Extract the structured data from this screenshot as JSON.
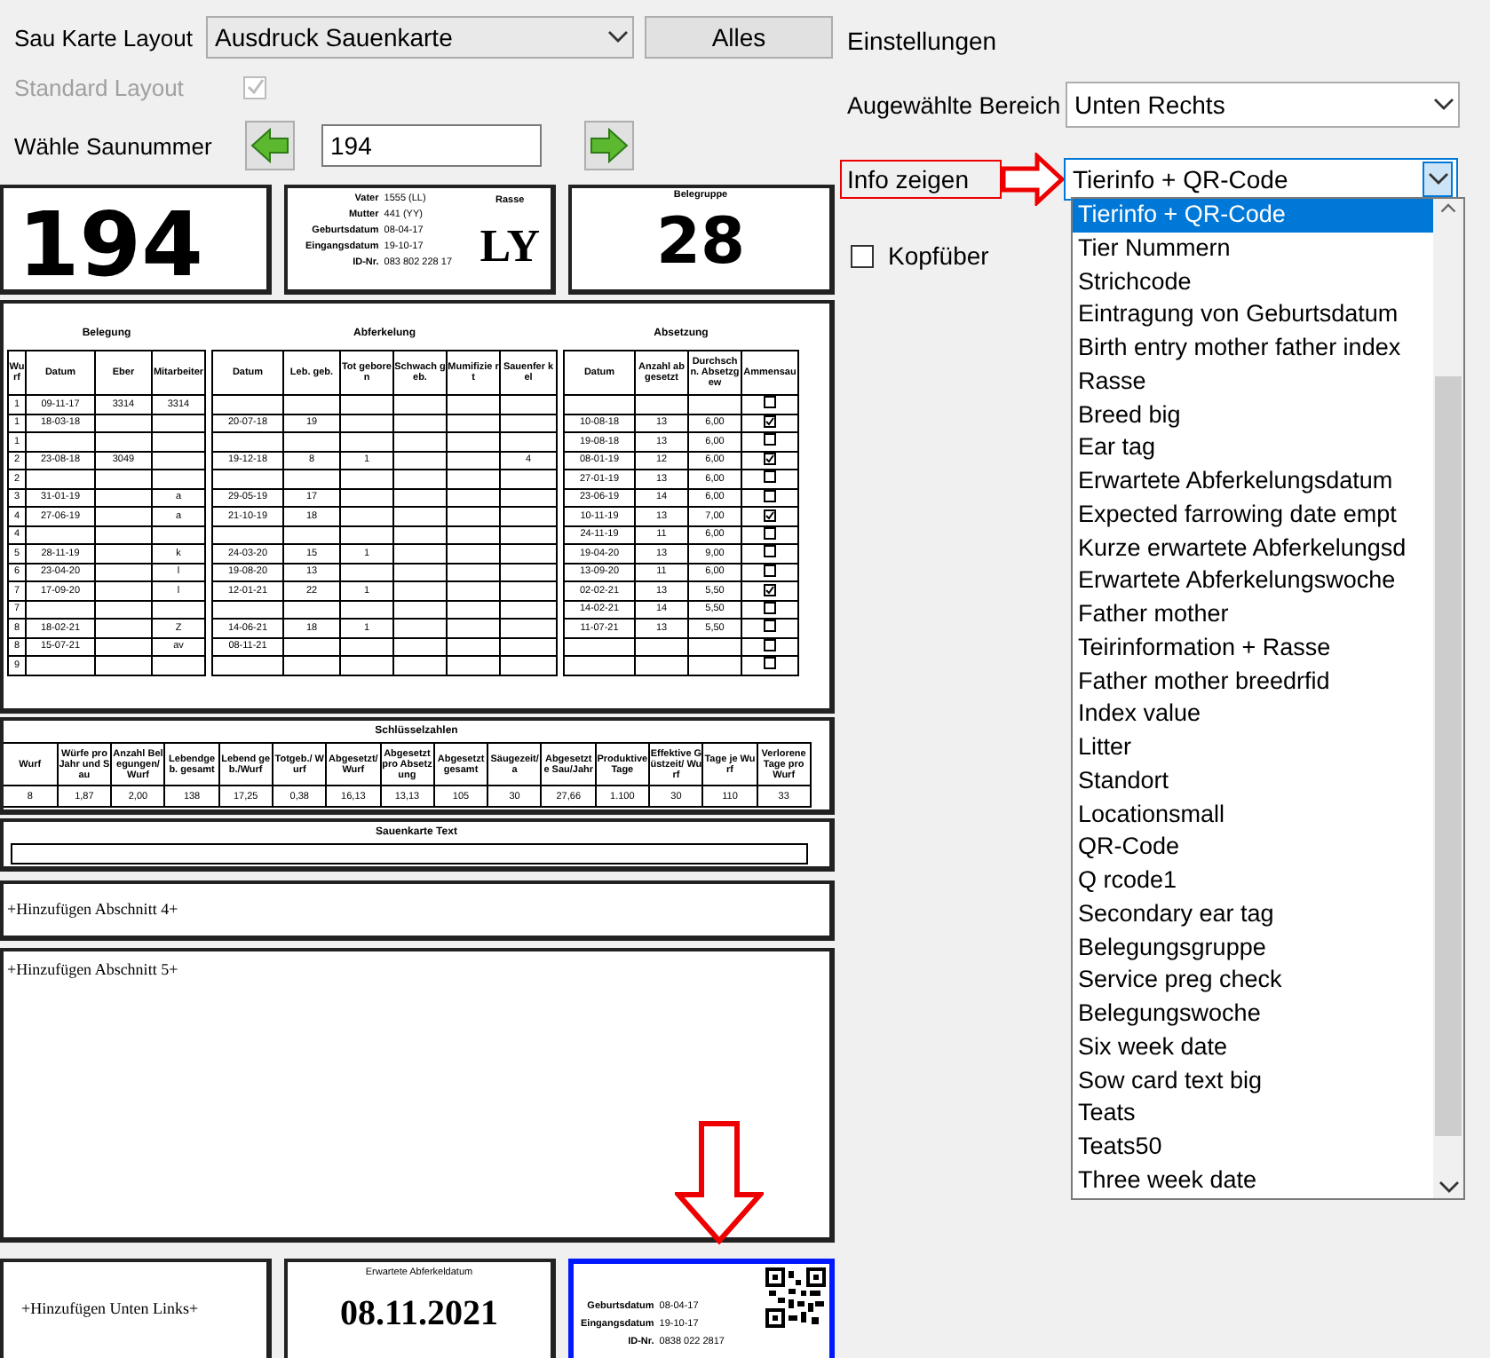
{
  "form": {
    "layout_label": "Sau Karte Layout",
    "layout_value": "Ausdruck Sauenkarte",
    "all_button": "Alles",
    "standard_layout": {
      "label": "Standard Layout",
      "checked": true,
      "disabled": true
    },
    "sow_label": "Wähle Saunummer",
    "sow_number": "194"
  },
  "card": {
    "sow_number": "194",
    "info": [
      {
        "label": "Vater",
        "value": "1555 (LL)"
      },
      {
        "label": "Mutter",
        "value": "441 (YY)"
      },
      {
        "label": "Geburtsdatum",
        "value": "08-04-17"
      },
      {
        "label": "Eingangsdatum",
        "value": "19-10-17"
      },
      {
        "label": "ID-Nr.",
        "value": "083 802 228 17"
      }
    ],
    "breed_label": "Rasse",
    "breed": "LY",
    "group_label": "Belegruppe",
    "group": "28",
    "history": {
      "groups": [
        {
          "title": "Belegung",
          "columns": [
            "Wurf",
            "Datum",
            "Eber",
            "Mitarbeiter"
          ]
        },
        {
          "title": "Abferkelung",
          "columns": [
            "Datum",
            "Leb. geb.",
            "Tot geboren",
            "Schwach geb.",
            "Mumifizie rt",
            "Sauenfer kel"
          ]
        },
        {
          "title": "Absetzung",
          "columns": [
            "Datum",
            "Anzahl abgesetzt",
            "Durchsch n. Absetzgew",
            "Ammensau"
          ]
        }
      ],
      "rows": [
        {
          "litter": "1",
          "mating_date": "09-11-17",
          "boar": "3314",
          "staff": "3314",
          "foster_sow": false
        },
        {
          "litter": "1",
          "mating_date": "18-03-18",
          "farrowing_date": "20-07-18",
          "born_alive": "19",
          "weaning_date": "10-08-18",
          "weaned": "13",
          "avg_weight": "6,00",
          "foster_sow": true
        },
        {
          "litter": "1",
          "weaning_date": "19-08-18",
          "weaned": "13",
          "avg_weight": "6,00",
          "foster_sow": false
        },
        {
          "litter": "2",
          "mating_date": "23-08-18",
          "boar": "3049",
          "farrowing_date": "19-12-18",
          "born_alive": "8",
          "stillborn": "1",
          "sow_piglets": "4",
          "weaning_date": "08-01-19",
          "weaned": "12",
          "avg_weight": "6,00",
          "foster_sow": true
        },
        {
          "litter": "2",
          "weaning_date": "27-01-19",
          "weaned": "13",
          "avg_weight": "6,00",
          "foster_sow": false
        },
        {
          "litter": "3",
          "mating_date": "31-01-19",
          "staff": "a",
          "farrowing_date": "29-05-19",
          "born_alive": "17",
          "weaning_date": "23-06-19",
          "weaned": "14",
          "avg_weight": "6,00",
          "foster_sow": false
        },
        {
          "litter": "4",
          "mating_date": "27-06-19",
          "staff": "a",
          "farrowing_date": "21-10-19",
          "born_alive": "18",
          "weaning_date": "10-11-19",
          "weaned": "13",
          "avg_weight": "7,00",
          "foster_sow": true
        },
        {
          "litter": "4",
          "weaning_date": "24-11-19",
          "weaned": "11",
          "avg_weight": "6,00",
          "foster_sow": false
        },
        {
          "litter": "5",
          "mating_date": "28-11-19",
          "staff": "k",
          "farrowing_date": "24-03-20",
          "born_alive": "15",
          "stillborn": "1",
          "weaning_date": "19-04-20",
          "weaned": "13",
          "avg_weight": "9,00",
          "foster_sow": false
        },
        {
          "litter": "6",
          "mating_date": "23-04-20",
          "staff": "l",
          "farrowing_date": "19-08-20",
          "born_alive": "13",
          "weaning_date": "13-09-20",
          "weaned": "11",
          "avg_weight": "6,00",
          "foster_sow": false
        },
        {
          "litter": "7",
          "mating_date": "17-09-20",
          "staff": "l",
          "farrowing_date": "12-01-21",
          "born_alive": "22",
          "stillborn": "1",
          "weaning_date": "02-02-21",
          "weaned": "13",
          "avg_weight": "5,50",
          "foster_sow": true
        },
        {
          "litter": "7",
          "weaning_date": "14-02-21",
          "weaned": "14",
          "avg_weight": "5,50",
          "foster_sow": false
        },
        {
          "litter": "8",
          "mating_date": "18-02-21",
          "staff": "Z",
          "farrowing_date": "14-06-21",
          "born_alive": "18",
          "stillborn": "1",
          "weaning_date": "11-07-21",
          "weaned": "13",
          "avg_weight": "5,50",
          "foster_sow": false
        },
        {
          "litter": "8",
          "mating_date": "15-07-21",
          "staff": "av",
          "farrowing_date": "08-11-21",
          "foster_sow": false
        },
        {
          "litter": "9",
          "foster_sow": false
        }
      ]
    },
    "key_figures": {
      "title": "Schlüsselzahlen",
      "columns": [
        "Wurf",
        "Würfe pro Jahr und Sau",
        "Anzahl Belegungen/ Wurf",
        "Lebendgeb. gesamt",
        "Lebend geb./Wurf",
        "Totgeb./ Wurf",
        "Abgesetzt/ Wurf",
        "Abgesetzt pro Absetzung",
        "Abgesetzt gesamt",
        "Säugezeit/ a",
        "Abgesetzte Sau/Jahr",
        "Produktive Tage",
        "Effektive Güstzeit/ Wurf",
        "Tage je Wurf",
        "Verlorene Tage pro Wurf"
      ],
      "values": [
        "8",
        "1,87",
        "2,00",
        "138",
        "17,25",
        "0,38",
        "16,13",
        "13,13",
        "105",
        "30",
        "27,66",
        "1.100",
        "30",
        "110",
        "33"
      ]
    },
    "text_section": {
      "title": "Sauenkarte Text"
    },
    "section_4": "+Hinzufügen Abschnitt 4+",
    "section_5": "+Hinzufügen Abschnitt 5+",
    "bottom_left": "+Hinzufügen Unten Links+",
    "expected": {
      "label": "Erwartete Abferkeldatum",
      "date": "08.11.2021"
    },
    "bottom_right": {
      "selected": true,
      "info": [
        {
          "label": "Geburtsdatum",
          "value": "08-04-17"
        },
        {
          "label": "Eingangsdatum",
          "value": "19-10-17"
        },
        {
          "label": "ID-Nr.",
          "value": "0838 022 2817"
        }
      ]
    }
  },
  "panel": {
    "title": "Einstellungen",
    "area_label": "Augewählte Bereich",
    "area_value": "Unten Rechts",
    "info_label": "Info zeigen",
    "info_select": {
      "value": "Tierinfo + QR-Code",
      "expanded": true,
      "options": [
        {
          "label": "Tierinfo + QR-Code",
          "selected": true
        },
        {
          "label": "Tier Nummern",
          "selected": false
        },
        {
          "label": "Strichcode",
          "selected": false
        },
        {
          "label": "Eintragung von Geburtsdatum",
          "selected": false
        },
        {
          "label": "Birth entry mother father index",
          "selected": false
        },
        {
          "label": "Rasse",
          "selected": false
        },
        {
          "label": "Breed big",
          "selected": false
        },
        {
          "label": "Ear tag",
          "selected": false
        },
        {
          "label": "Erwartete Abferkelungsdatum",
          "selected": false
        },
        {
          "label": "Expected  farrowing  date empt",
          "selected": false
        },
        {
          "label": "Kurze  erwartete Abferkelungsd",
          "selected": false
        },
        {
          "label": "Erwartete Abferkelungswoche",
          "selected": false
        },
        {
          "label": "Father mother",
          "selected": false
        },
        {
          "label": "Teirinformation + Rasse",
          "selected": false
        },
        {
          "label": "Father mother breedrfid",
          "selected": false
        },
        {
          "label": "Index value",
          "selected": false
        },
        {
          "label": "Litter",
          "selected": false
        },
        {
          "label": "Standort",
          "selected": false
        },
        {
          "label": "Locationsmall",
          "selected": false
        },
        {
          "label": "QR-Code",
          "selected": false
        },
        {
          "label": "Q rcode1",
          "selected": false
        },
        {
          "label": "Secondary ear tag",
          "selected": false
        },
        {
          "label": "Belegungsgruppe",
          "selected": false
        },
        {
          "label": "Service preg check",
          "selected": false
        },
        {
          "label": "Belegungswoche",
          "selected": false
        },
        {
          "label": "Six week date",
          "selected": false
        },
        {
          "label": "Sow card text big",
          "selected": false
        },
        {
          "label": "Teats",
          "selected": false
        },
        {
          "label": "Teats50",
          "selected": false
        },
        {
          "label": "Three week date",
          "selected": false
        }
      ]
    },
    "upside_down": {
      "label": "Kopfüber",
      "checked": false
    }
  }
}
